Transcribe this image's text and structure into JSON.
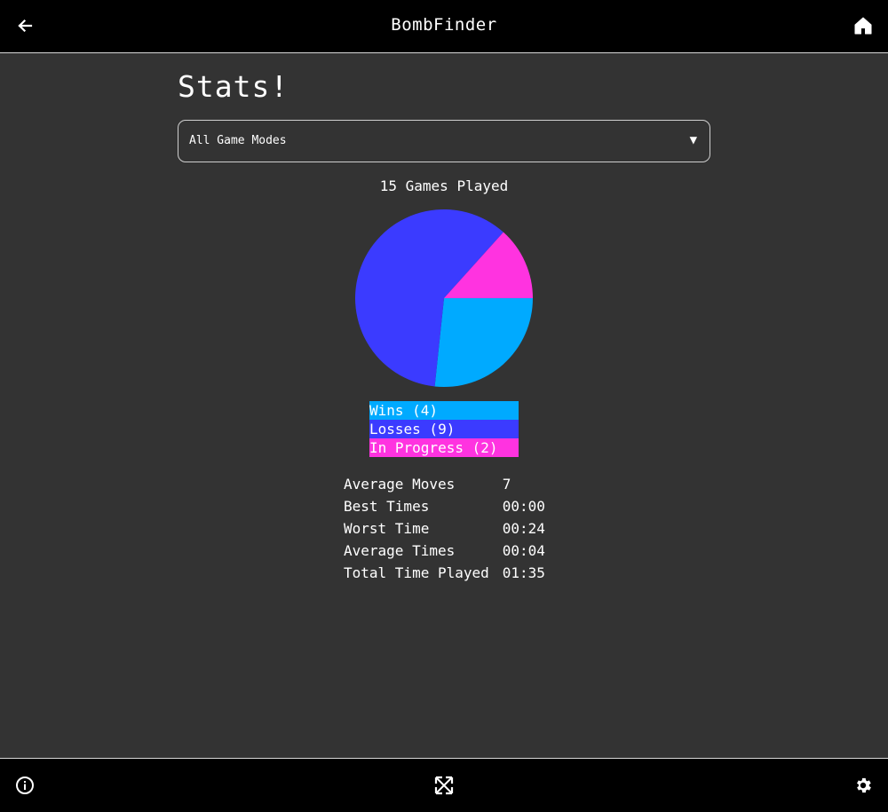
{
  "app": {
    "title": "BombFinder"
  },
  "header": {
    "back_icon": "arrow-left-icon",
    "home_icon": "home-icon"
  },
  "page": {
    "heading": "Stats!"
  },
  "game_mode_select": {
    "selected": "All Game Modes",
    "caret": "▼"
  },
  "summary": {
    "games_played": "15 Games Played"
  },
  "colors": {
    "wins": "#00aaff",
    "losses": "#3b3bff",
    "in_progress": "#ff33e0",
    "background": "#333333",
    "bar": "#000000"
  },
  "chart_data": {
    "type": "pie",
    "slices": [
      {
        "label": "Wins (4)",
        "value": 4,
        "color": "#00aaff"
      },
      {
        "label": "Losses (9)",
        "value": 9,
        "color": "#3b3bff"
      },
      {
        "label": "In Progress (2)",
        "value": 2,
        "color": "#ff33e0"
      }
    ],
    "legend": [
      "Wins (4)",
      "Losses (9)",
      "In Progress (2)"
    ]
  },
  "stats": {
    "rows": [
      {
        "label": "Average Moves",
        "value": "7"
      },
      {
        "label": "Best Times",
        "value": "00:00"
      },
      {
        "label": "Worst Time",
        "value": "00:24"
      },
      {
        "label": "Average Times",
        "value": "00:04"
      },
      {
        "label": "Total Time Played",
        "value": "01:35"
      }
    ]
  },
  "footer": {
    "info_icon": "info-icon",
    "fullscreen_icon": "fullscreen-icon",
    "settings_icon": "gear-icon"
  }
}
